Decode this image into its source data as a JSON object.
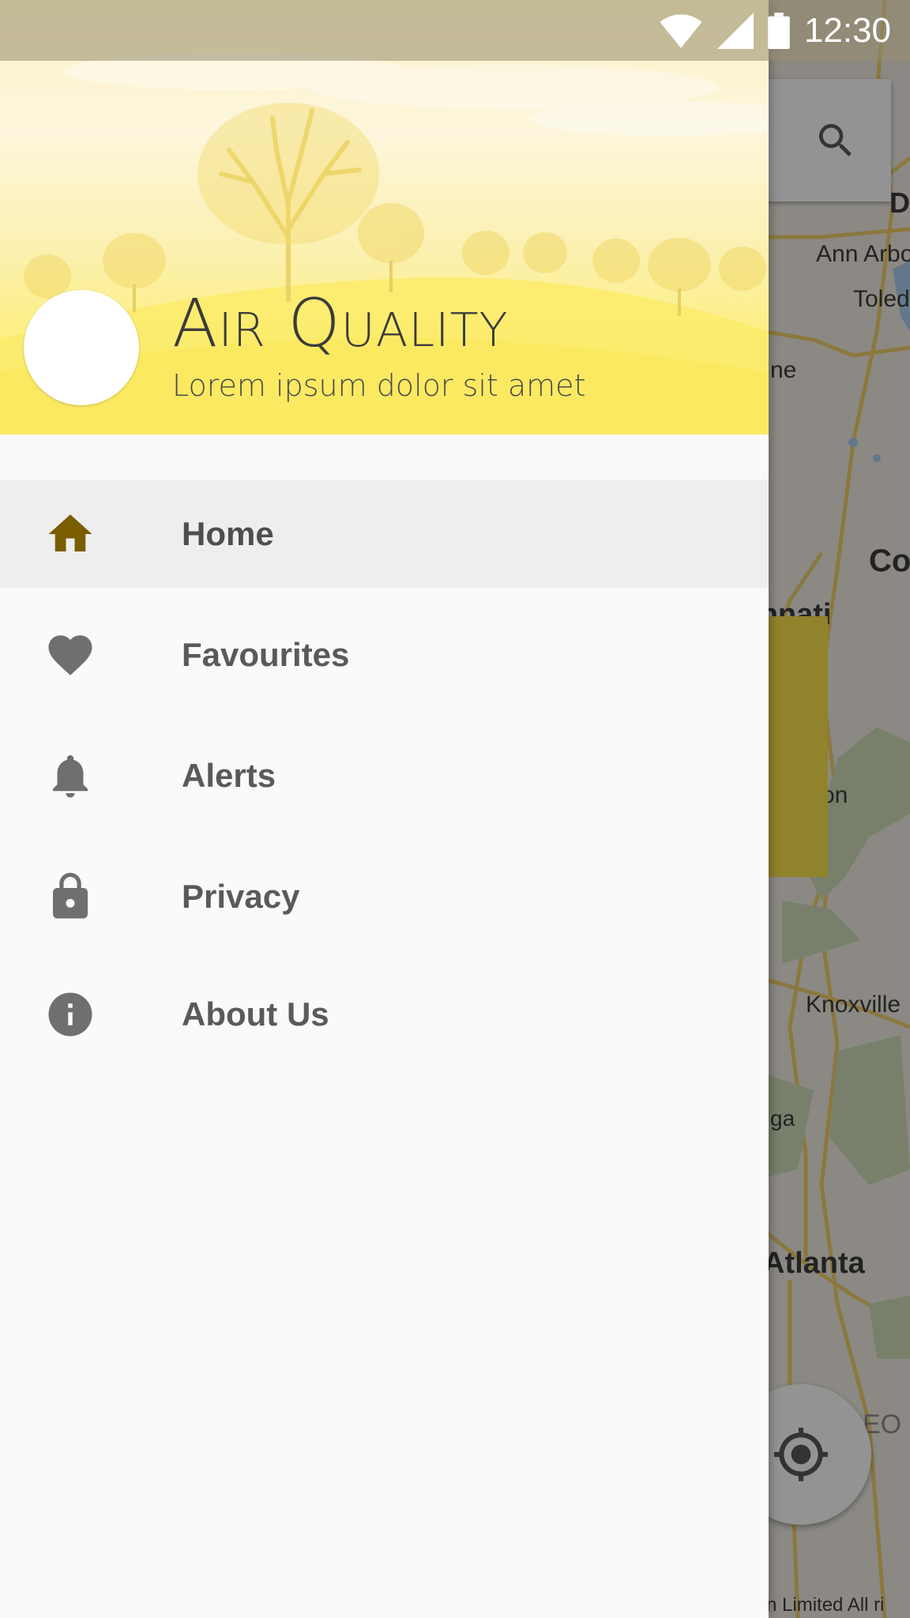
{
  "status_bar": {
    "time": "12:30",
    "icons": [
      "wifi-icon",
      "signal-icon",
      "battery-icon"
    ]
  },
  "drawer": {
    "header": {
      "title": "Air Quality",
      "subtitle": "Lorem ipsum dolor sit amet"
    },
    "menu": [
      {
        "label": "Home",
        "icon": "home-icon",
        "selected": true
      },
      {
        "label": "Favourites",
        "icon": "heart-icon",
        "selected": false
      },
      {
        "label": "Alerts",
        "icon": "bell-icon",
        "selected": false
      },
      {
        "label": "Privacy",
        "icon": "lock-icon",
        "selected": false
      },
      {
        "label": "About Us",
        "icon": "info-icon",
        "selected": false
      }
    ]
  },
  "map": {
    "labels": [
      "Ann Arbo",
      "Toled",
      "ne",
      "Co",
      "cinnati",
      "on",
      "Knoxville",
      "ga",
      "Atlanta",
      "EO",
      "n Limited  All ri",
      "D"
    ]
  },
  "colors": {
    "accent_yellow": "#fbee75",
    "selected_icon": "#7a5d00",
    "icon_gray": "#6f6f6f",
    "drawer_bg": "#fafafa",
    "selected_row": "#eeeeee"
  }
}
